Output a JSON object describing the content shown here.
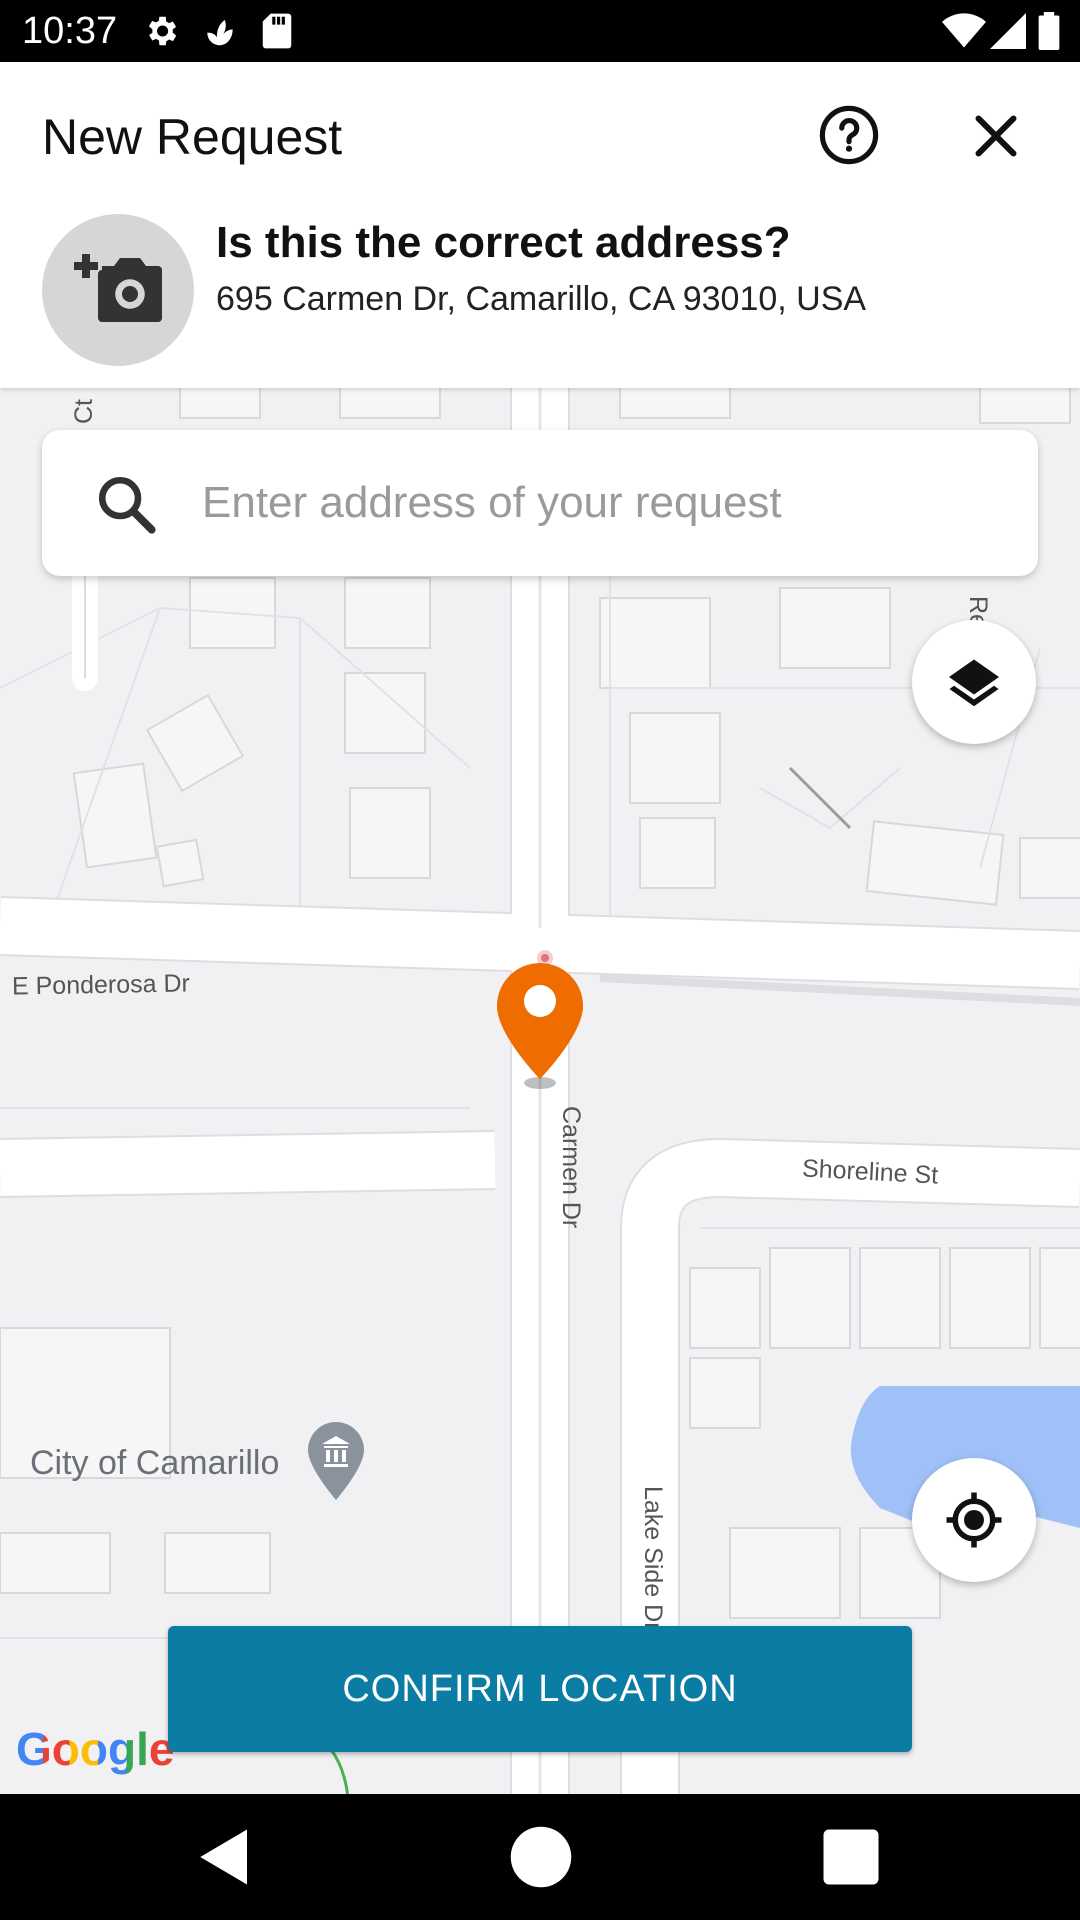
{
  "status_bar": {
    "time": "10:37",
    "left_icons": [
      "settings-icon",
      "plant-icon",
      "sd-card-icon"
    ],
    "right_icons": [
      "wifi-icon",
      "cell-signal-icon",
      "battery-icon"
    ]
  },
  "header": {
    "title": "New Request",
    "help_icon": "help-circle-icon",
    "close_icon": "close-icon",
    "photo_icon": "add-photo-icon",
    "question": "Is this the correct address?",
    "address": "695 Carmen Dr, Camarillo, CA 93010, USA"
  },
  "search": {
    "placeholder": "Enter address of your request",
    "icon": "search-icon"
  },
  "map": {
    "streets": {
      "ponderosa": "E Ponderosa Dr",
      "carmen": "Carmen Dr",
      "shoreline": "Shoreline St",
      "lakeside": "Lake Side Dr",
      "ct": "Ct",
      "re": "Re"
    },
    "poi": "City of Camarillo",
    "layers_icon": "layers-icon",
    "locate_icon": "my-location-icon",
    "pin_icon": "map-pin-icon",
    "attribution": "Google",
    "colors": {
      "pin": "#ef6c00",
      "water": "#9fc1f7",
      "button": "#0b7ca3"
    }
  },
  "confirm_button": "CONFIRM LOCATION",
  "nav_bar": {
    "icons": [
      "back-icon",
      "home-icon",
      "recents-icon"
    ]
  }
}
